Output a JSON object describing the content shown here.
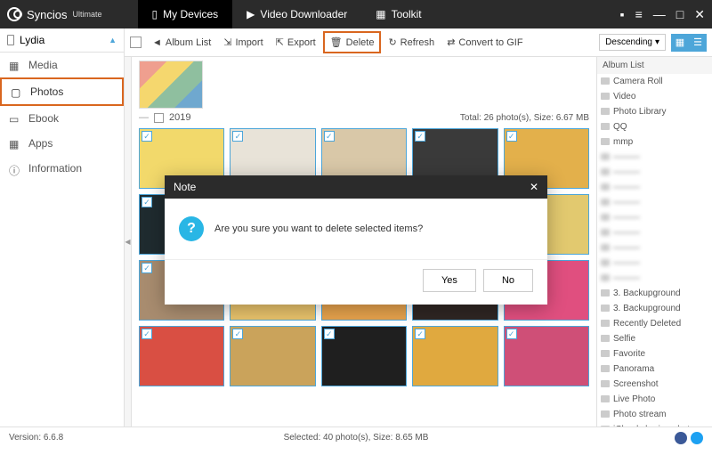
{
  "app": {
    "name": "Syncios",
    "edition": "Ultimate"
  },
  "topnav": [
    {
      "label": "My Devices",
      "active": true
    },
    {
      "label": "Video Downloader",
      "active": false
    },
    {
      "label": "Toolkit",
      "active": false
    }
  ],
  "device": {
    "name": "Lydia"
  },
  "sidebar": [
    {
      "label": "Media",
      "active": false
    },
    {
      "label": "Photos",
      "active": true
    },
    {
      "label": "Ebook",
      "active": false
    },
    {
      "label": "Apps",
      "active": false
    },
    {
      "label": "Information",
      "active": false
    }
  ],
  "toolbar": {
    "album_list": "Album List",
    "import": "Import",
    "export": "Export",
    "delete": "Delete",
    "refresh": "Refresh",
    "gif": "Convert to GIF",
    "sort": "Descending"
  },
  "year": "2019",
  "summary": "Total: 26 photo(s), Size: 6.67 MB",
  "albums": {
    "header": "Album List",
    "items": [
      "Camera Roll",
      "Video",
      "Photo Library",
      "QQ",
      "mmp",
      "",
      "",
      "",
      "",
      "",
      "",
      "",
      "",
      "",
      "3. Backupground",
      "3. Backupground",
      "Recently Deleted",
      "Selfie",
      "Favorite",
      "Panorama",
      "Screenshot",
      "Live Photo",
      "Photo stream",
      "iCloud sharing photo"
    ]
  },
  "modal": {
    "title": "Note",
    "message": "Are you sure you want to delete selected items?",
    "yes": "Yes",
    "no": "No"
  },
  "status": {
    "version": "Version: 6.6.8",
    "selection": "Selected: 40 photo(s), Size: 8.65 MB"
  },
  "thumb_colors": [
    "#f2d96b",
    "#e8e3d8",
    "#d9c8a8",
    "#3a3a3a",
    "#e3b04b",
    "#1f2b2f",
    "#222",
    "#f0d373",
    "#d98b3f",
    "#e2c96f",
    "#a88c6f",
    "#e8c26b",
    "#e6a24c",
    "#2f2623",
    "#e04f7f",
    "#d94f43",
    "#caa35b",
    "#1f1f1f",
    "#e0a93f",
    "#cf4f77"
  ]
}
